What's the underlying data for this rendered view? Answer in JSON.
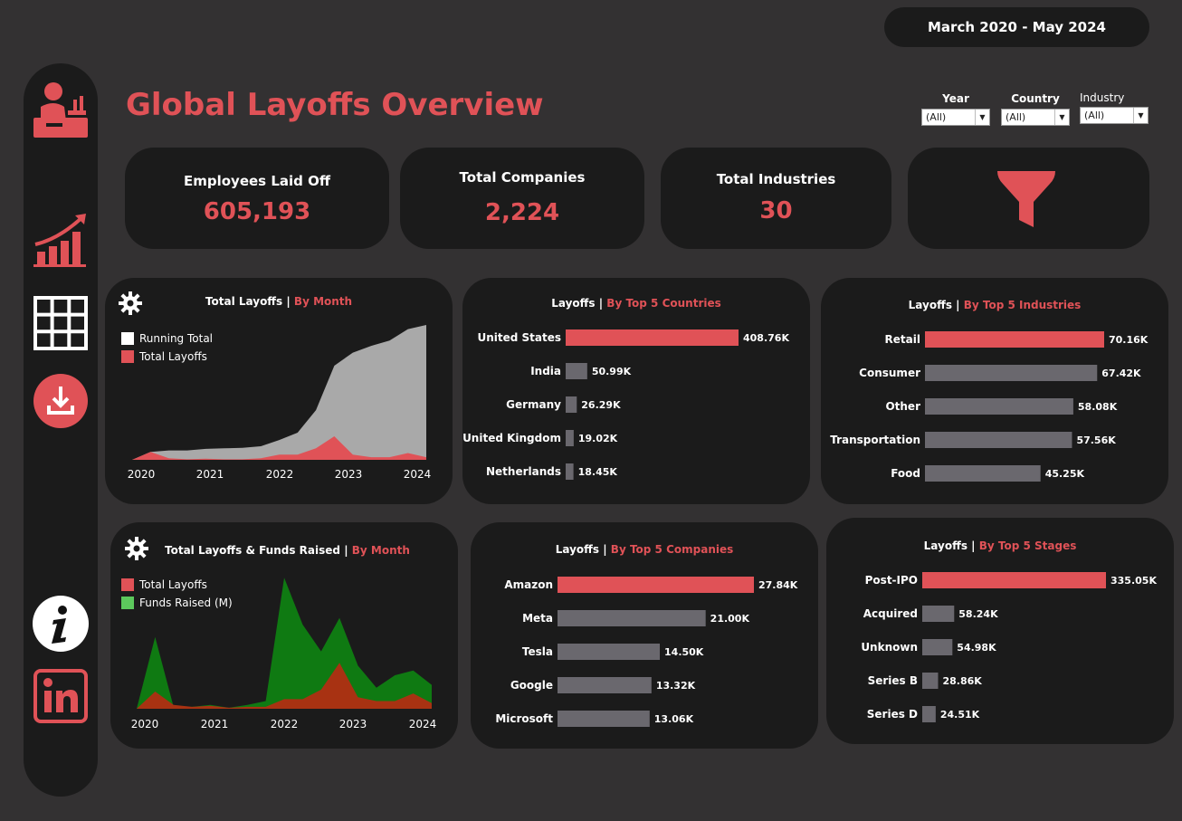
{
  "header": {
    "date_range": "March 2020 - May 2024",
    "title": "Global Layoffs Overview"
  },
  "filters": [
    {
      "label": "Year",
      "value": "(All)"
    },
    {
      "label": "Country",
      "value": "(All)"
    },
    {
      "label": "Industry",
      "value": "(All)"
    }
  ],
  "kpis": {
    "employees": {
      "label": "Employees Laid Off",
      "value": "605,193"
    },
    "companies": {
      "label": "Total Companies",
      "value": "2,224"
    },
    "industries": {
      "label": "Total Industries",
      "value": "30"
    }
  },
  "sidebar": {
    "icons": [
      "employee-desk-icon",
      "growth-chart-icon",
      "table-grid-icon",
      "download-icon",
      "info-icon",
      "linkedin-icon"
    ]
  },
  "colors": {
    "accent": "#e05257",
    "bar_gray": "#6a686e",
    "green": "#0f7a12",
    "green_legend": "#5cc85c",
    "running_total": "#a9a9a9"
  },
  "chart_data": [
    {
      "id": "layoffs-by-month",
      "type": "area",
      "title_main": "Total Layoffs",
      "title_accent": "By Month",
      "x_ticks": [
        "2020",
        "2021",
        "2022",
        "2023",
        "2024"
      ],
      "series": [
        {
          "name": "Running Total",
          "values": [
            0,
            15,
            18,
            18,
            21,
            22,
            23,
            26,
            38,
            52,
            95,
            180,
            205,
            218,
            228,
            250,
            258
          ]
        },
        {
          "name": "Total Layoffs",
          "values": [
            0,
            15,
            3,
            1,
            2,
            1,
            1,
            3,
            10,
            10,
            22,
            45,
            10,
            5,
            5,
            13,
            5
          ]
        }
      ]
    },
    {
      "id": "layoffs-funds-by-month",
      "type": "area",
      "title_main": "Total Layoffs & Funds Raised",
      "title_accent": "By Month",
      "x_ticks": [
        "2020",
        "2021",
        "2022",
        "2023",
        "2024"
      ],
      "series": [
        {
          "name": "Total Layoffs",
          "values": [
            0,
            18,
            4,
            2,
            3,
            1,
            2,
            2,
            10,
            10,
            20,
            48,
            12,
            8,
            8,
            16,
            6
          ]
        },
        {
          "name": "Funds Raised (M)",
          "values": [
            0,
            75,
            2,
            2,
            4,
            1,
            4,
            8,
            137,
            88,
            60,
            95,
            45,
            22,
            35,
            40,
            25
          ]
        }
      ]
    },
    {
      "id": "top-countries",
      "type": "bar",
      "title_main": "Layoffs",
      "title_accent": "By Top 5 Countries",
      "categories": [
        "United States",
        "India",
        "Germany",
        "United Kingdom",
        "Netherlands"
      ],
      "values": [
        408.76,
        50.99,
        26.29,
        19.02,
        18.45
      ],
      "labels": [
        "408.76K",
        "50.99K",
        "26.29K",
        "19.02K",
        "18.45K"
      ]
    },
    {
      "id": "top-industries",
      "type": "bar",
      "title_main": "Layoffs",
      "title_accent": "By Top 5 Industries",
      "categories": [
        "Retail",
        "Consumer",
        "Other",
        "Transportation",
        "Food"
      ],
      "values": [
        70.16,
        67.42,
        58.08,
        57.56,
        45.25
      ],
      "labels": [
        "70.16K",
        "67.42K",
        "58.08K",
        "57.56K",
        "45.25K"
      ]
    },
    {
      "id": "top-companies",
      "type": "bar",
      "title_main": "Layoffs",
      "title_accent": "By Top 5 Companies",
      "categories": [
        "Amazon",
        "Meta",
        "Tesla",
        "Google",
        "Microsoft"
      ],
      "values": [
        27.84,
        21.0,
        14.5,
        13.32,
        13.06
      ],
      "labels": [
        "27.84K",
        "21.00K",
        "14.50K",
        "13.32K",
        "13.06K"
      ]
    },
    {
      "id": "top-stages",
      "type": "bar",
      "title_main": "Layoffs",
      "title_accent": "By Top 5 Stages",
      "categories": [
        "Post-IPO",
        "Acquired",
        "Unknown",
        "Series B",
        "Series D"
      ],
      "values": [
        335.05,
        58.24,
        54.98,
        28.86,
        24.51
      ],
      "labels": [
        "335.05K",
        "58.24K",
        "54.98K",
        "28.86K",
        "24.51K"
      ]
    }
  ]
}
